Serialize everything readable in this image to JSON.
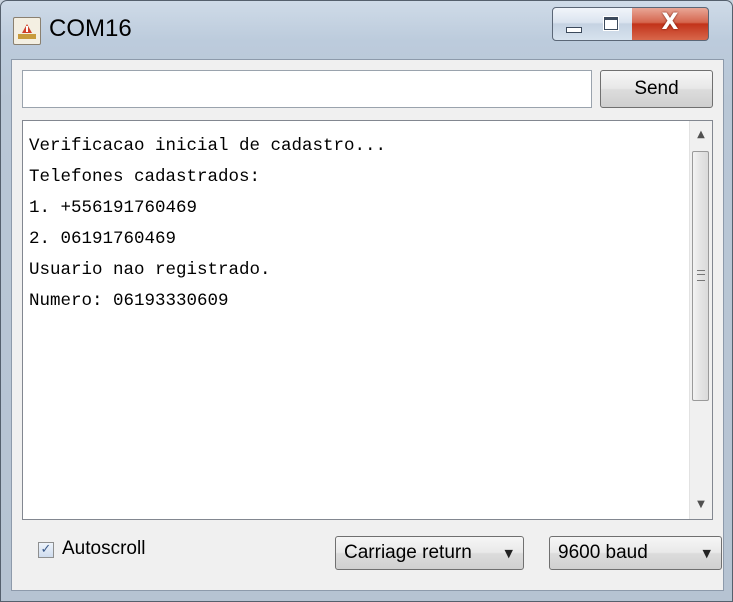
{
  "window": {
    "title": "COM16",
    "close_glyph": "X"
  },
  "send": {
    "input_value": "",
    "button_label": "Send"
  },
  "output": {
    "lines": [
      "Verificacao inicial de cadastro...",
      "Telefones cadastrados:",
      "1. +556191760469",
      "2. 06191760469",
      "Usuario nao registrado.",
      "Numero: 06193330609"
    ],
    "scroll_up_glyph": "▲",
    "scroll_down_glyph": "▼"
  },
  "footer": {
    "autoscroll_checked": true,
    "autoscroll_check_glyph": "✓",
    "autoscroll_label": "Autoscroll",
    "line_ending_selected": "Carriage return",
    "baud_selected": "9600 baud",
    "dropdown_glyph": "▼"
  },
  "icons": [
    "arduino-app-icon",
    "minimize-icon",
    "maximize-icon",
    "close-icon",
    "scroll-up-icon",
    "scroll-down-icon",
    "scrollbar-grip-icon",
    "checkbox-check-icon",
    "chevron-down-icon"
  ]
}
